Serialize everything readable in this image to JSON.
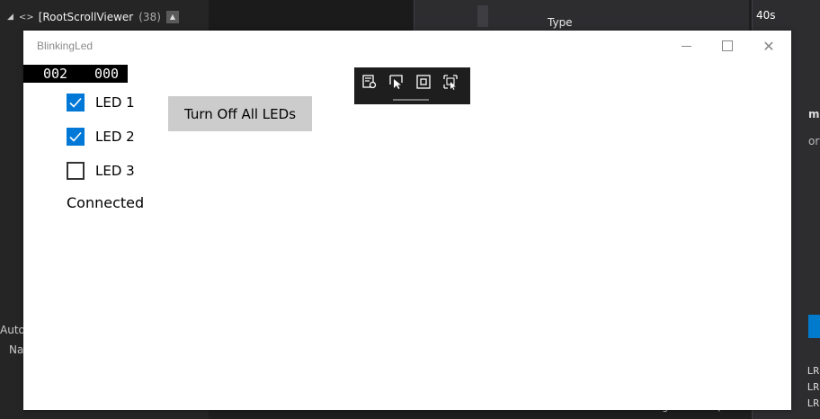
{
  "background": {
    "tree_row": {
      "code_glyph": "<>",
      "label": "[RootScrollViewer",
      "count": "(38)"
    },
    "grid_header": {
      "type": "Type"
    },
    "timeline": {
      "time": "40s",
      "partial_a": "mo",
      "partial_b": "ory",
      "lines": [
        "LR",
        "LR",
        "LR"
      ]
    },
    "left_partial": [
      "Auto",
      "Na"
    ],
    "bottom_text": "BlinkingLed.exe  (CoreCLR"
  },
  "app": {
    "title": "BlinkingLed",
    "frame_counter": {
      "left": "002",
      "right": "000"
    },
    "leds": [
      {
        "label": "LED 1",
        "checked": true
      },
      {
        "label": "LED 2",
        "checked": true
      },
      {
        "label": "LED 3",
        "checked": false
      }
    ],
    "status": "Connected",
    "turn_off_button": "Turn Off All LEDs"
  },
  "debug_toolbar": {
    "icons": [
      "live-visual-tree-icon",
      "select-element-icon",
      "display-layout-adorners-icon",
      "track-focus-icon"
    ]
  },
  "colors": {
    "accent": "#0078d7",
    "button_bg": "#cccccc",
    "window_bg": "#ffffff",
    "ide_bg": "#1e1e1e"
  }
}
